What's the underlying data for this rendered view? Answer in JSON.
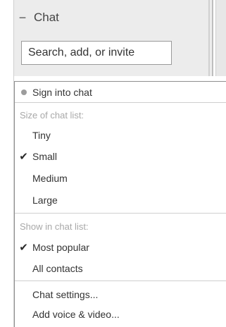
{
  "chat_panel": {
    "title": "Chat",
    "collapse_symbol": "−",
    "search_placeholder": "Search, add, or invite"
  },
  "menu": {
    "sign_in": "Sign into chat",
    "size_header": "Size of chat list:",
    "size_options": [
      "Tiny",
      "Small",
      "Medium",
      "Large"
    ],
    "size_selected": "Small",
    "show_header": "Show in chat list:",
    "show_options": [
      "Most popular",
      "All contacts"
    ],
    "show_selected": "Most popular",
    "settings": "Chat settings...",
    "voice_video": "Add voice & video..."
  },
  "icons": {
    "check": "✔",
    "status": "status-dot-icon"
  },
  "colors": {
    "panel_background": "#ececec",
    "section_label": "#a8a8a8",
    "status_dot": "#9c9c9c"
  }
}
